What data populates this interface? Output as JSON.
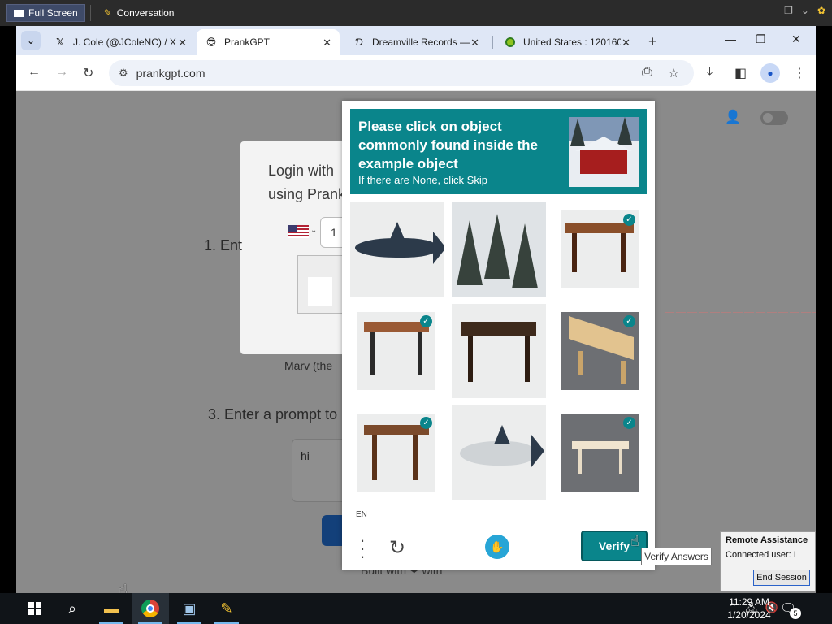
{
  "remote_session": {
    "full_screen_label": "Full Screen",
    "conversation_label": "Conversation"
  },
  "browser": {
    "tabs": [
      {
        "title": "J. Cole (@JColeNC) / X",
        "icon": "x-logo-icon"
      },
      {
        "title": "PrankGPT",
        "icon": "sunglasses-emoji-icon",
        "active": true
      },
      {
        "title": "Dreamville Records —",
        "icon": "dreamville-logo-icon"
      },
      {
        "title": "United States : 120160",
        "icon": "globe-icon"
      }
    ],
    "url": "prankgpt.com"
  },
  "page": {
    "login_title_line1": "Login with",
    "login_title_line2": "using Prank",
    "country_code": "1",
    "step1": "1. Ent",
    "marv": "Marv (the",
    "step3": "3. Enter a prompt to",
    "prompt_value": "hi",
    "built_with": "Built with ❤ with"
  },
  "captcha": {
    "prompt": "Please click on object commonly found inside the example object",
    "subprompt": "If there are None, click Skip",
    "tiles": [
      {
        "object": "shark",
        "selected": false
      },
      {
        "object": "pine-trees",
        "selected": false
      },
      {
        "object": "wooden-table",
        "selected": true
      },
      {
        "object": "wooden-table",
        "selected": true
      },
      {
        "object": "dark-wooden-table",
        "selected": false
      },
      {
        "object": "light-wooden-table",
        "selected": true
      },
      {
        "object": "wooden-table",
        "selected": true
      },
      {
        "object": "white-shark",
        "selected": false
      },
      {
        "object": "white-table",
        "selected": true
      }
    ],
    "language": "EN",
    "verify_label": "Verify",
    "verify_tooltip": "Verify Answers",
    "accent_color": "#0a858b"
  },
  "remote_assistance": {
    "title": "Remote Assistance",
    "connected_user": "Connected user: I",
    "end_session_label": "End Session"
  },
  "taskbar": {
    "time": "11:29 AM",
    "date": "1/20/2024",
    "notification_count": "5"
  }
}
